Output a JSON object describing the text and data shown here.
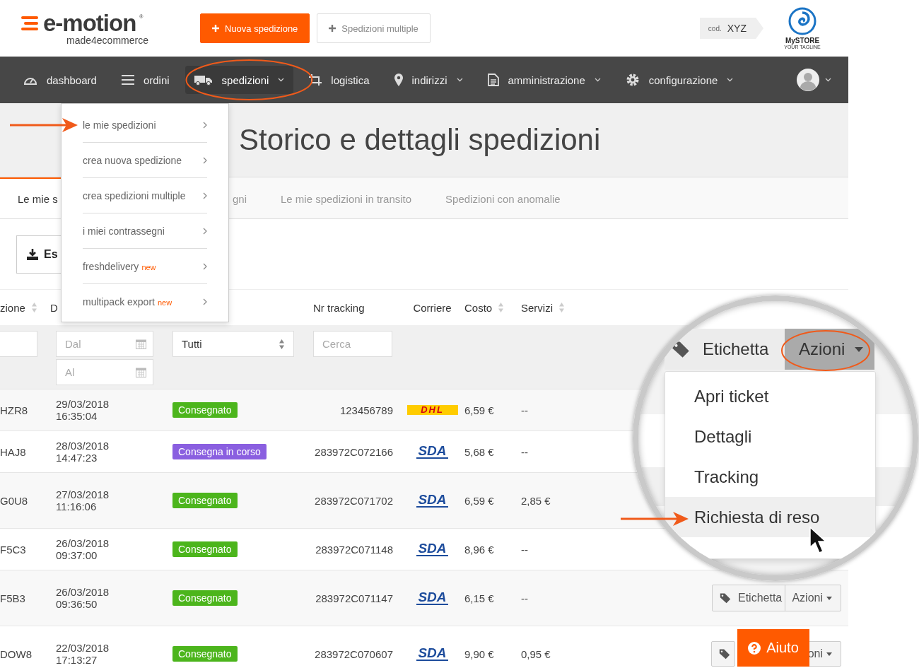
{
  "header": {
    "logo": {
      "name": "e-motion",
      "mark": "®",
      "tagline": "made4ecommerce"
    },
    "buttons": [
      {
        "label": "Nuova spedizione",
        "kind": "primary"
      },
      {
        "label": "Spedizioni multiple",
        "kind": "secondary"
      }
    ],
    "account_code": {
      "label": "cod.",
      "value": "XYZ"
    },
    "store": {
      "name": "MySTORE",
      "tagline": "YOUR TAGLINE"
    }
  },
  "nav": {
    "items": [
      {
        "label": "dashboard",
        "has_menu": false,
        "selected": false
      },
      {
        "label": "ordini",
        "has_menu": false,
        "selected": false
      },
      {
        "label": "spedizioni",
        "has_menu": true,
        "selected": true
      },
      {
        "label": "logistica",
        "has_menu": false,
        "selected": false
      },
      {
        "label": "indirizzi",
        "has_menu": true,
        "selected": false
      },
      {
        "label": "amministrazione",
        "has_menu": true,
        "selected": false
      },
      {
        "label": "configurazione",
        "has_menu": true,
        "selected": false
      }
    ]
  },
  "nav_menu": {
    "items": [
      {
        "label": "le mie spedizioni"
      },
      {
        "label": "crea nuova spedizione"
      },
      {
        "label": "crea spedizioni multiple"
      },
      {
        "label": "i miei contrassegni"
      },
      {
        "label": "freshdelivery",
        "badge": "new"
      },
      {
        "label": "multipack export",
        "badge": "new"
      }
    ]
  },
  "page_title": "Storico e dettagli spedizioni",
  "tabs": [
    {
      "label": "Le mie s",
      "selected": true
    },
    {
      "label": "gni",
      "selected": false
    },
    {
      "label": "Le mie spedizioni in transito",
      "selected": false
    },
    {
      "label": "Spedizioni con anomalie",
      "selected": false
    }
  ],
  "export_button": {
    "label": "Es"
  },
  "table": {
    "columns": [
      {
        "label": "zione",
        "sortable": true
      },
      {
        "label": "D",
        "sortable": false
      },
      {
        "label": "Nr tracking",
        "sortable": false
      },
      {
        "label": "Corriere",
        "sortable": false
      },
      {
        "label": "Costo",
        "sortable": true
      },
      {
        "label": "Servizi",
        "sortable": true
      }
    ],
    "filters": {
      "date_from": {
        "placeholder": "Dal"
      },
      "date_to": {
        "placeholder": "Al"
      },
      "status": {
        "value": "Tutti"
      },
      "tracking": {
        "placeholder": "Cerca"
      }
    },
    "rows": [
      {
        "code": "HZR8",
        "date": "29/03/2018",
        "time": "16:35:04",
        "status": {
          "label": "Consegnato",
          "color": "#4cb51c"
        },
        "tracking": "123456789",
        "carrier": {
          "kind": "dhl",
          "label": "DHL"
        },
        "cost": "6,59 €",
        "services": "--"
      },
      {
        "code": "HAJ8",
        "date": "28/03/2018",
        "time": "14:47:23",
        "status": {
          "label": "Consegna in corso",
          "color": "#8a5fe0"
        },
        "tracking": "283972C072166",
        "carrier": {
          "kind": "sda",
          "label": "SDA"
        },
        "cost": "5,68 €",
        "services": "--"
      },
      {
        "code": "G0U8",
        "date": "27/03/2018",
        "time": "11:16:06",
        "status": {
          "label": "Consegnato",
          "color": "#4cb51c"
        },
        "tracking": "283972C071702",
        "carrier": {
          "kind": "sda",
          "label": "SDA"
        },
        "cost": "6,59 €",
        "services": "2,85 €"
      },
      {
        "code": "F5C3",
        "date": "26/03/2018",
        "time": "09:37:00",
        "status": {
          "label": "Consegnato",
          "color": "#4cb51c"
        },
        "tracking": "283972C071148",
        "carrier": {
          "kind": "sda",
          "label": "SDA"
        },
        "cost": "8,96 €",
        "services": "--"
      },
      {
        "code": "F5B3",
        "date": "26/03/2018",
        "time": "09:36:50",
        "status": {
          "label": "Consegnato",
          "color": "#4cb51c"
        },
        "tracking": "283972C071147",
        "carrier": {
          "kind": "sda",
          "label": "SDA"
        },
        "cost": "6,15 €",
        "services": "--",
        "actions": [
          {
            "kind": "label",
            "label": "Etichetta"
          },
          {
            "kind": "menu",
            "label": "Azioni"
          }
        ]
      },
      {
        "code": "DOW8",
        "date": "22/03/2018",
        "time": "17:13:27",
        "status": {
          "label": "Consegnato",
          "color": "#4cb51c"
        },
        "tracking": "283972C070607",
        "carrier": {
          "kind": "sda",
          "label": "SDA"
        },
        "cost": "9,90 €",
        "services": "0,95 €",
        "actions": [
          {
            "kind": "label"
          },
          {
            "kind": "menu",
            "label": "oni"
          }
        ]
      }
    ]
  },
  "magnifier": {
    "buttons": [
      {
        "kind": "label",
        "label": "Etichetta",
        "selected": false
      },
      {
        "kind": "menu",
        "label": "Azioni",
        "selected": true
      }
    ],
    "menu": [
      {
        "label": "Apri ticket",
        "hovered": false
      },
      {
        "label": "Dettagli",
        "hovered": false
      },
      {
        "label": "Tracking",
        "hovered": false
      },
      {
        "label": "Richiesta di reso",
        "hovered": true
      }
    ]
  },
  "help_button": {
    "label": "Aiuto"
  }
}
